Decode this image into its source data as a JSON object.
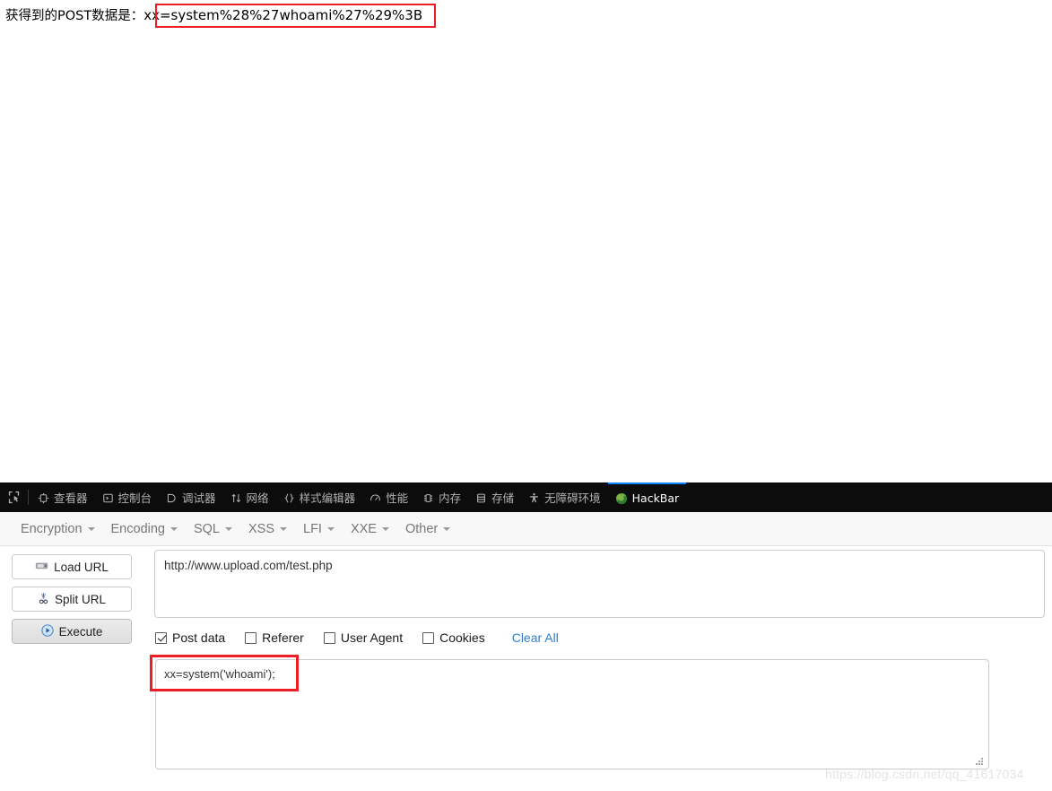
{
  "page": {
    "post_result_label": "获得到的POST数据是：",
    "post_result_value": "xx=system%28%27whoami%27%29%3B"
  },
  "devtools": {
    "picker_icon": "element-picker-icon",
    "tabs": [
      {
        "label": "查看器",
        "icon": "inspector-icon",
        "selected": false
      },
      {
        "label": "控制台",
        "icon": "console-icon",
        "selected": false
      },
      {
        "label": "调试器",
        "icon": "debugger-icon",
        "selected": false
      },
      {
        "label": "网络",
        "icon": "network-icon",
        "selected": false
      },
      {
        "label": "样式编辑器",
        "icon": "style-editor-icon",
        "selected": false
      },
      {
        "label": "性能",
        "icon": "performance-icon",
        "selected": false
      },
      {
        "label": "内存",
        "icon": "memory-icon",
        "selected": false
      },
      {
        "label": "存储",
        "icon": "storage-icon",
        "selected": false
      },
      {
        "label": "无障碍环境",
        "icon": "accessibility-icon",
        "selected": false
      },
      {
        "label": "HackBar",
        "icon": "hackbar-icon",
        "selected": true
      }
    ],
    "selected_tab": "HackBar",
    "accent_color": "#0a84ff",
    "background_color": "#0c0c0d",
    "text_color": "#b1b1b3"
  },
  "hackbar": {
    "menu": [
      {
        "label": "Encryption"
      },
      {
        "label": "Encoding"
      },
      {
        "label": "SQL"
      },
      {
        "label": "XSS"
      },
      {
        "label": "LFI"
      },
      {
        "label": "XXE"
      },
      {
        "label": "Other"
      }
    ],
    "buttons": [
      {
        "label": "Load URL",
        "icon": "load-url-icon",
        "pressed": false
      },
      {
        "label": "Split URL",
        "icon": "scissors-icon",
        "pressed": false
      },
      {
        "label": "Execute",
        "icon": "play-icon",
        "pressed": true
      }
    ],
    "url_field": {
      "value": "http://www.upload.com/test.php",
      "placeholder": ""
    },
    "options": [
      {
        "label": "Post data",
        "checked": true
      },
      {
        "label": "Referer",
        "checked": false
      },
      {
        "label": "User Agent",
        "checked": false
      },
      {
        "label": "Cookies",
        "checked": false
      }
    ],
    "clear_all_label": "Clear All",
    "post_data_field": {
      "value": "xx=system('whoami');",
      "placeholder": ""
    },
    "link_color": "#2f7fd1"
  },
  "annotations": {
    "color": "#ee1c24",
    "boxes": [
      {
        "name": "post-result-highlight"
      },
      {
        "name": "post-data-highlight"
      }
    ]
  },
  "watermark": {
    "text": "https://blog.csdn.net/qq_41617034"
  }
}
